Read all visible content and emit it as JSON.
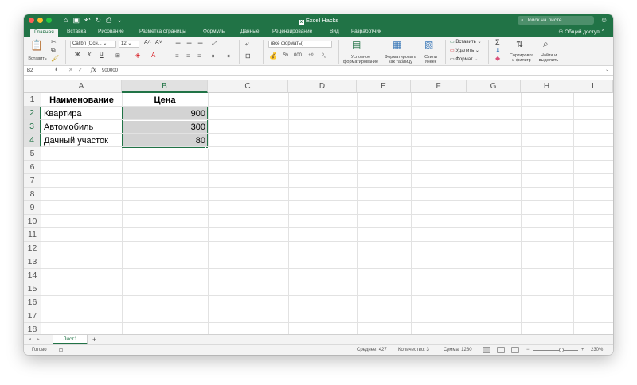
{
  "window": {
    "doc_title": "Excel Hacks",
    "search_placeholder": "Поиск на листе",
    "share_label": "Общий доступ"
  },
  "tabs": [
    "Главная",
    "Вставка",
    "Рисование",
    "Разметка страницы",
    "Формулы",
    "Данные",
    "Рецензирование",
    "Вид",
    "Разработчик"
  ],
  "ribbon": {
    "paste_label": "Вставить",
    "font_name": "Calibri (Осн...",
    "font_size": "12",
    "number_format": "(все форматы)",
    "cond_format_label": "Условное форматирование",
    "format_table_label": "Форматировать как таблицу",
    "cell_styles_label": "Стили ячеек",
    "insert_label": "Вставить",
    "delete_label": "Удалить",
    "format_label": "Формат",
    "sort_filter_label": "Сортировка и фильтр",
    "find_select_label": "Найти и выделить",
    "percent_symbol": "%",
    "thousands_symbol": "000"
  },
  "formula_bar": {
    "name_box": "B2",
    "fx": "fx",
    "value": "900000"
  },
  "grid": {
    "columns": [
      "A",
      "B",
      "C",
      "D",
      "E",
      "F",
      "G",
      "H",
      "I"
    ],
    "rows": [
      "1",
      "2",
      "3",
      "4",
      "5",
      "6",
      "7",
      "8",
      "9",
      "10",
      "11",
      "12",
      "13",
      "14",
      "15",
      "16",
      "17",
      "18"
    ],
    "header_name": "Наименование",
    "header_price": "Цена",
    "items": [
      {
        "name": "Квартира",
        "price": "900"
      },
      {
        "name": "Автомобиль",
        "price": "300"
      },
      {
        "name": "Дачный участок",
        "price": "80"
      }
    ]
  },
  "sheets": {
    "active": "Лист1",
    "add": "+"
  },
  "status": {
    "ready": "Готово",
    "average": "Среднее: 427",
    "count": "Количество: 3",
    "sum": "Сумма: 1280",
    "zoom": "230%"
  },
  "colors": {
    "accent": "#217346",
    "selection_fill": "#d3d3d3"
  }
}
